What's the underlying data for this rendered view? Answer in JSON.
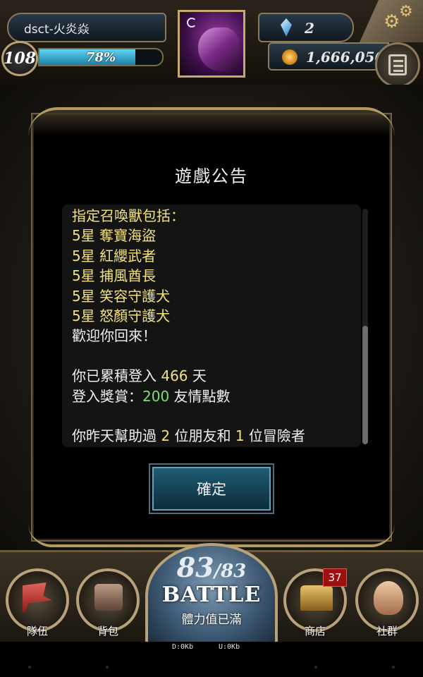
{
  "hud": {
    "player_name": "dsct-火炎焱",
    "level": "108",
    "exp_percent_text": "78%",
    "exp_fraction": 0.78,
    "gems": "2",
    "coins": "1,666,056"
  },
  "dialog": {
    "title": "遊戲公告",
    "lines": [
      [
        {
          "t": "指定召喚獸包括：",
          "c": "yellow"
        }
      ],
      [
        {
          "t": "5星 奪寶海盜",
          "c": "yellow"
        }
      ],
      [
        {
          "t": "5星 紅纓武者",
          "c": "yellow"
        }
      ],
      [
        {
          "t": "5星 捕風酋長",
          "c": "yellow"
        }
      ],
      [
        {
          "t": "5星 笑容守護犬",
          "c": "yellow"
        }
      ],
      [
        {
          "t": "5星 怒顏守護犬",
          "c": "yellow"
        }
      ],
      [
        {
          "t": "歡迎你回來！",
          "c": "white"
        }
      ],
      [],
      [
        {
          "t": "你已累積登入 ",
          "c": "white"
        },
        {
          "t": "466",
          "c": "yellow"
        },
        {
          "t": " 天",
          "c": "white"
        }
      ],
      [
        {
          "t": "登入獎賞：",
          "c": "white"
        },
        {
          "t": "200",
          "c": "green"
        },
        {
          "t": " 友情點數",
          "c": "white"
        }
      ],
      [],
      [
        {
          "t": "你昨天幫助過 ",
          "c": "white"
        },
        {
          "t": "2",
          "c": "yellow"
        },
        {
          "t": " 位朋友和 ",
          "c": "white"
        },
        {
          "t": "1",
          "c": "yellow"
        },
        {
          "t": " 位冒險者",
          "c": "white"
        }
      ]
    ],
    "confirm_label": "確定"
  },
  "nav": {
    "team_label": "隊伍",
    "bag_label": "背包",
    "shop_label": "商店",
    "social_label": "社群",
    "shop_badge": "37",
    "stamina_current": "83",
    "stamina_max": "/83",
    "battle_label": "BATTLE",
    "stamina_status": "體力值已滿"
  },
  "system": {
    "download": "D:0Kb",
    "upload": "U:0Kb"
  },
  "colors": {
    "text_yellow": "#f3e27b",
    "text_green": "#7de06e",
    "frame_gold": "#b39a62",
    "button_blue": "#1d5c74"
  }
}
